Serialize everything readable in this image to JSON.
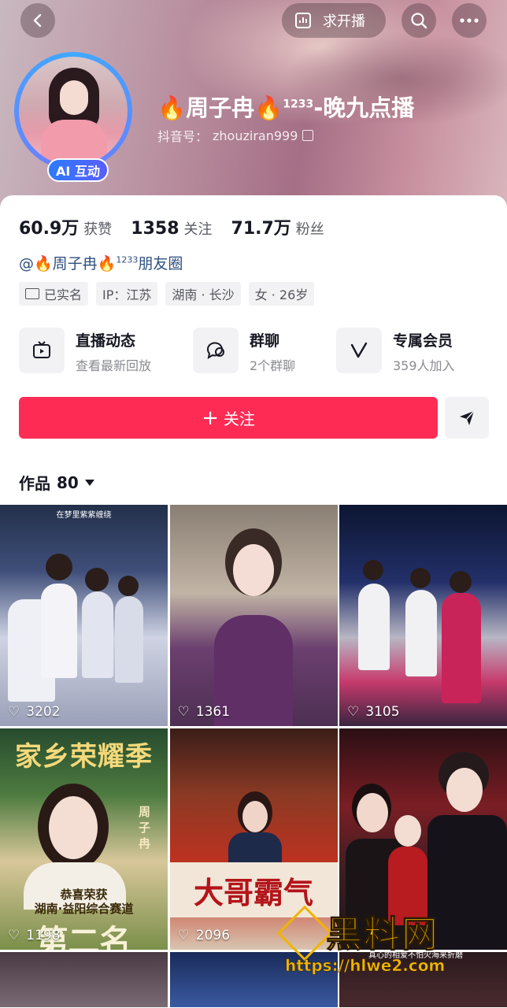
{
  "header": {
    "request_live_label": "求开播",
    "name": "🔥周子冉🔥",
    "name_sup": "1233",
    "name_suffix": "-晚九点播",
    "douyin_id_label": "抖音号：",
    "douyin_id": "zhouziran999",
    "ai_badge": "AI 互动"
  },
  "stats": [
    {
      "num": "60.9万",
      "label": "获赞"
    },
    {
      "num": "1358",
      "label": "关注"
    },
    {
      "num": "71.7万",
      "label": "粉丝"
    }
  ],
  "friend_circle": {
    "prefix": "@🔥周子冉🔥",
    "sup": "1233",
    "suffix": "朋友圈"
  },
  "tags": [
    "已实名",
    "IP：江苏",
    "湖南 · 长沙",
    "女 · 26岁"
  ],
  "features": [
    {
      "title": "直播动态",
      "sub": "查看最新回放",
      "icon": "tv-icon"
    },
    {
      "title": "群聊",
      "sub": "2个群聊",
      "icon": "chat-bubble-icon"
    },
    {
      "title": "专属会员",
      "sub": "359人加入",
      "icon": "v-member-icon"
    }
  ],
  "follow_label": "关注",
  "works_tab": {
    "label": "作品",
    "count": "80"
  },
  "videos": [
    {
      "likes": "3202",
      "caption": "在梦里紫紫缠绕"
    },
    {
      "likes": "1361"
    },
    {
      "likes": "3105"
    },
    {
      "likes": "1198",
      "caption_top": "家乡荣耀季",
      "caption_mid": "恭喜荣获\n湖南·益阳综合赛道",
      "caption_big": "第二名",
      "side_name": "周子冉"
    },
    {
      "likes": "2096",
      "banner": "大哥霸气"
    },
    {
      "likes": ""
    }
  ],
  "watermark": {
    "title": "黑料网",
    "url": "https://hlwe2.com",
    "caption": "真心的相爱不怕火海来折磨"
  },
  "colors": {
    "accent": "#fe2c55",
    "link": "#2f4f7f",
    "ai_badge": "#2c7bff",
    "watermark": "#f0b400"
  }
}
